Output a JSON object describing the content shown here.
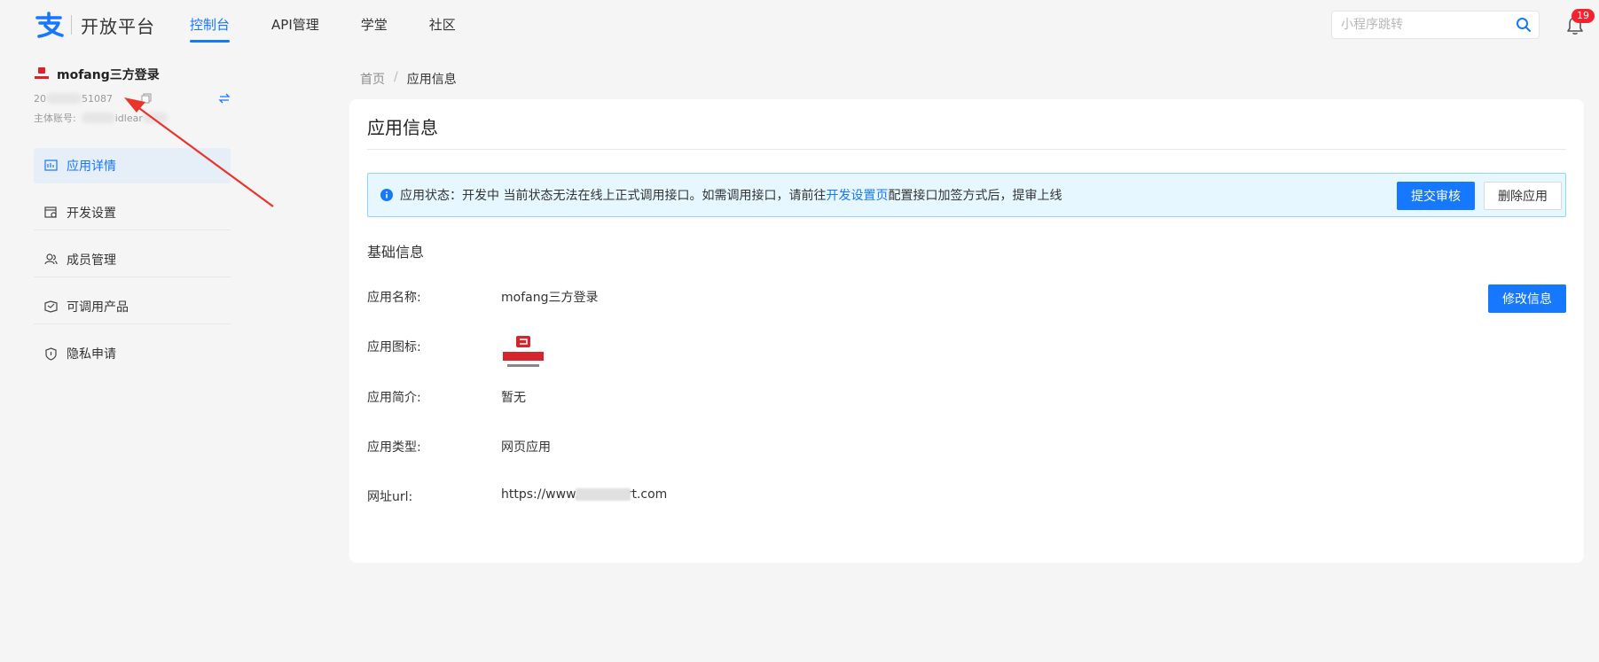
{
  "header": {
    "logo_text": "开放平台",
    "nav": [
      {
        "label": "控制台",
        "active": true
      },
      {
        "label": "API管理",
        "active": false
      },
      {
        "label": "学堂",
        "active": false
      },
      {
        "label": "社区",
        "active": false
      }
    ],
    "search_placeholder": "小程序跳转",
    "notification_count": "19"
  },
  "sidebar": {
    "app_name": "mofang三方登录",
    "app_id_prefix": "20",
    "app_id_suffix": "51087",
    "owner_label": "主体账号:",
    "owner_visible_fragment": "idlear",
    "menu": [
      {
        "label": "应用详情",
        "icon": "app-detail-icon",
        "active": true
      },
      {
        "label": "开发设置",
        "icon": "dev-settings-icon",
        "active": false
      },
      {
        "label": "成员管理",
        "icon": "members-icon",
        "active": false
      },
      {
        "label": "可调用产品",
        "icon": "products-icon",
        "active": false
      },
      {
        "label": "隐私申请",
        "icon": "privacy-icon",
        "active": false
      }
    ]
  },
  "breadcrumb": {
    "home": "首页",
    "separator": "/",
    "current": "应用信息"
  },
  "main": {
    "title": "应用信息",
    "alert": {
      "prefix": "应用状态：开发中 当前状态无法在线上正式调用接口。如需调用接口，请前往",
      "link": "开发设置页",
      "suffix": "配置接口加签方式后，提审上线",
      "submit_label": "提交审核",
      "delete_label": "删除应用"
    },
    "section_title": "基础信息",
    "edit_label": "修改信息",
    "fields": {
      "name_label": "应用名称:",
      "name_value": "mofang三方登录",
      "icon_label": "应用图标:",
      "intro_label": "应用简介:",
      "intro_value": "暂无",
      "type_label": "应用类型:",
      "type_value": "网页应用",
      "url_label": "网址url:",
      "url_prefix": "https://www.",
      "url_suffix": "rt.com"
    }
  },
  "colors": {
    "primary": "#1677ff",
    "alert_bg": "#e6f7ff",
    "badge": "#f5222d",
    "annotation_arrow": "#e8362f"
  }
}
